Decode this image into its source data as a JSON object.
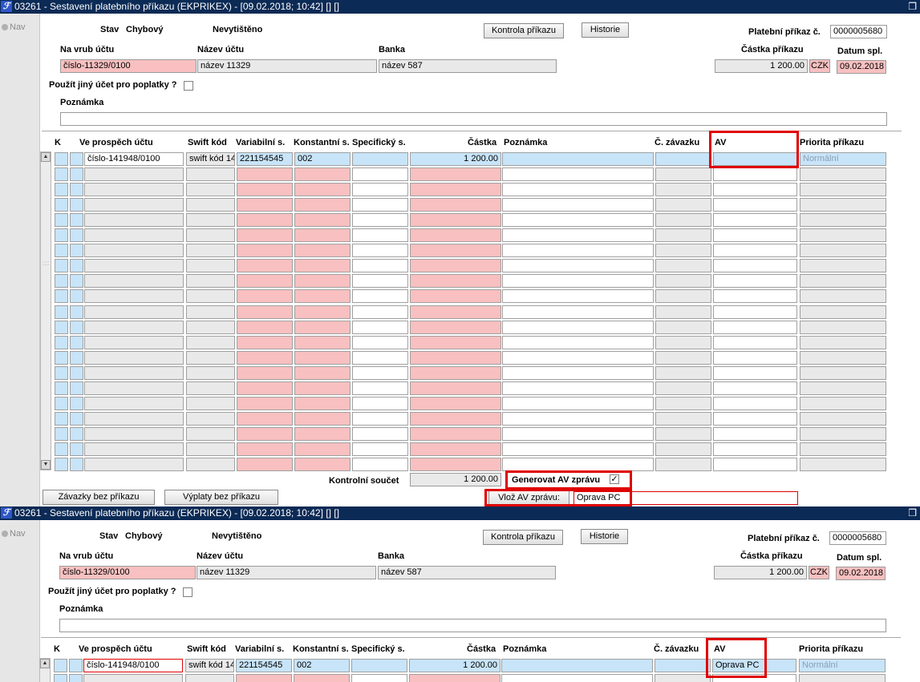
{
  "window1": {
    "title": "03261 - Sestavení platebního příkazu (EKPRIKEX) - [09.02.2018; 10:42]  []  []",
    "nav_label": "Nav",
    "stav_label": "Stav",
    "stav_value": "Chybový",
    "tisk_value": "Nevytištěno",
    "kontrola_button": "Kontrola příkazu",
    "historie_button": "Historie",
    "prikaz_label": "Platební příkaz č.",
    "prikaz_value": "0000005680",
    "vrub_label": "Na vrub účtu",
    "vrub_value": "číslo-11329/0100",
    "nazev_label": "Název účtu",
    "nazev_value": "název 11329",
    "banka_label": "Banka",
    "banka_value": "název 587",
    "castka_label": "Částka příkazu",
    "castka_value": "1 200.00",
    "mena_value": "CZK",
    "datum_label": "Datum spl.",
    "datum_value": "09.02.2018",
    "jiny_ucet_label": "Použít jiný účet pro poplatky ?",
    "poznamka_label": "Poznámka",
    "poznamka_value": "",
    "columns": {
      "k": "K",
      "ucet": "Ve prospěch účtu",
      "swift": "Swift kód",
      "vs": "Variabilní s.",
      "ks": "Konstantní s.",
      "ss": "Specifický s.",
      "castka": "Částka",
      "pozn": "Poznámka",
      "zavazek": "Č. závazku",
      "av": "AV",
      "priorita": "Priorita příkazu"
    },
    "row1": {
      "ucet": "číslo-141948/0100",
      "swift": "swift kód 14",
      "vs": "221154545",
      "ks": "002",
      "ss": "",
      "castka": "1 200.00",
      "pozn": "",
      "zavazek": "",
      "av": "",
      "priorita": "Normální"
    },
    "kontrolni_label": "Kontrolní součet",
    "kontrolni_value": "1 200.00",
    "generovat_label": "Generovat AV zprávu",
    "generovat_check": "✓",
    "zavazky_button": "Závazky bez příkazu",
    "vyplaty_button": "Výplaty bez příkazu",
    "vloz_label": "Vlož AV zprávu:",
    "vloz_value": "Oprava PC"
  },
  "window2": {
    "title": "03261 - Sestavení platebního příkazu (EKPRIKEX) - [09.02.2018; 10:42]  []  []",
    "nav_label": "Nav",
    "stav_label": "Stav",
    "stav_value": "Chybový",
    "tisk_value": "Nevytištěno",
    "kontrola_button": "Kontrola příkazu",
    "historie_button": "Historie",
    "prikaz_label": "Platební příkaz č.",
    "prikaz_value": "0000005680",
    "vrub_label": "Na vrub účtu",
    "vrub_value": "číslo-11329/0100",
    "nazev_label": "Název účtu",
    "nazev_value": "název 11329",
    "banka_label": "Banka",
    "banka_value": "název 587",
    "castka_label": "Částka příkazu",
    "castka_value": "1 200.00",
    "mena_value": "CZK",
    "datum_label": "Datum spl.",
    "datum_value": "09.02.2018",
    "jiny_ucet_label": "Použít jiný účet pro poplatky ?",
    "poznamka_label": "Poznámka",
    "poznamka_value": "",
    "columns": {
      "k": "K",
      "ucet": "Ve prospěch účtu",
      "swift": "Swift kód",
      "vs": "Variabilní s.",
      "ks": "Konstantní s.",
      "ss": "Specifický s.",
      "castka": "Částka",
      "pozn": "Poznámka",
      "zavazek": "Č. závazku",
      "av": "AV",
      "priorita": "Priorita příkazu"
    },
    "row1": {
      "ucet": "číslo-141948/0100",
      "swift": "swift kód 14",
      "vs": "221154545",
      "ks": "002",
      "ss": "",
      "castka": "1 200.00",
      "pozn": "",
      "zavazek": "",
      "av": "Oprava PC",
      "priorita": "Normální"
    }
  },
  "colors": {
    "titlebar": "#0b2a55",
    "required_field": "#f8c0c0",
    "selected_row": "#c8e4f8",
    "highlight": "#e00000"
  },
  "icons": [
    "app-icon",
    "restore-window-icon",
    "nav-radio-icon",
    "scroll-up-icon",
    "scroll-down-icon",
    "checkbox-icon"
  ]
}
